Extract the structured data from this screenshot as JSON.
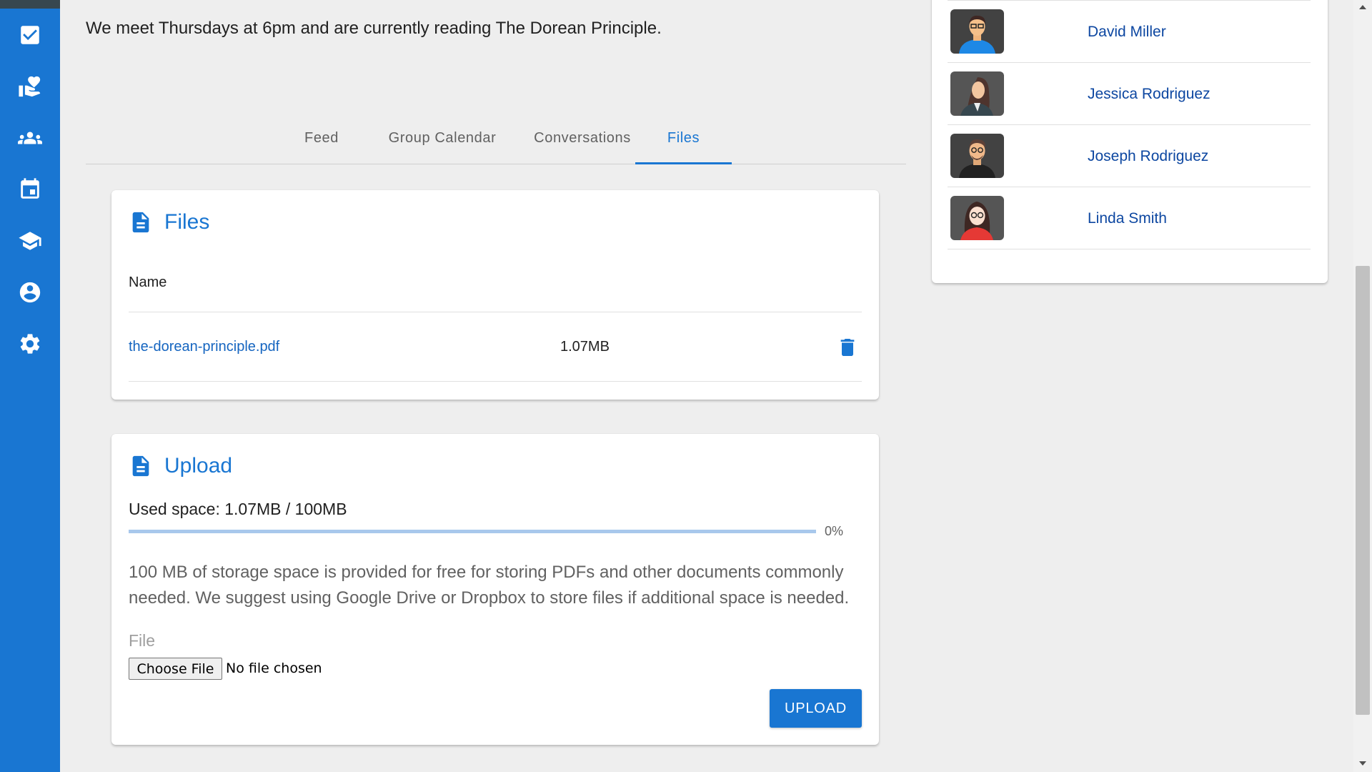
{
  "sidebar": {
    "items": [
      {
        "icon": "checkbox-icon"
      },
      {
        "icon": "hand-heart-icon"
      },
      {
        "icon": "group-icon"
      },
      {
        "icon": "calendar-icon"
      },
      {
        "icon": "school-icon"
      },
      {
        "icon": "account-circle-icon"
      },
      {
        "icon": "gear-icon"
      }
    ]
  },
  "group": {
    "description": "We meet Thursdays at 6pm and are currently reading The Dorean Principle."
  },
  "tabs": [
    {
      "label": "Feed",
      "active": false
    },
    {
      "label": "Group Calendar",
      "active": false
    },
    {
      "label": "Conversations",
      "active": false
    },
    {
      "label": "Files",
      "active": true
    }
  ],
  "files_card": {
    "title": "Files",
    "column_name": "Name",
    "files": [
      {
        "name": "the-dorean-principle.pdf",
        "size": "1.07MB"
      }
    ]
  },
  "upload_card": {
    "title": "Upload",
    "used_space": "Used space: 1.07MB / 100MB",
    "progress_percent": 0,
    "progress_label": "0%",
    "info": "100 MB of storage space is provided for free for storing PDFs and other documents commonly needed. We suggest using Google Drive or Dropbox to store files if additional space is needed.",
    "file_label": "File",
    "choose_file_label": "Choose File",
    "no_file_text": "No file chosen",
    "upload_button": "UPLOAD"
  },
  "members": [
    {
      "name": "David Miller"
    },
    {
      "name": "Jessica Rodriguez"
    },
    {
      "name": "Joseph Rodriguez"
    },
    {
      "name": "Linda Smith"
    }
  ],
  "colors": {
    "primary": "#1976d2",
    "sidebar": "#1976d2",
    "link": "#1565c0",
    "background": "#eeeeee"
  }
}
